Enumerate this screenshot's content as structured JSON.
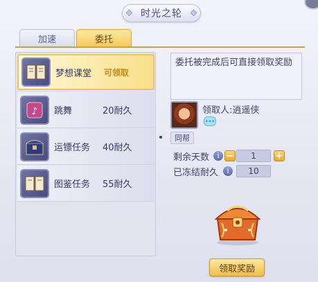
{
  "window": {
    "title": "时光之轮"
  },
  "tabs": [
    {
      "label": "加速",
      "active": false
    },
    {
      "label": "委托",
      "active": true
    }
  ],
  "tasks": [
    {
      "name": "梦想课堂",
      "status": "可领取",
      "icon": "book-icon",
      "selected": true
    },
    {
      "name": "跳舞",
      "cost": "20耐久",
      "icon": "music-scroll-icon",
      "selected": false
    },
    {
      "name": "运镖任务",
      "cost": "40耐久",
      "icon": "treasure-chest-icon",
      "selected": false
    },
    {
      "name": "图鉴任务",
      "cost": "55耐久",
      "icon": "book-icon",
      "selected": false
    }
  ],
  "detail": {
    "description": "委托被完成后可直接领取奖励",
    "receiver": "领取人:逍遥侠",
    "chat_icon": "chat-bubble-icon",
    "tag": "同帮",
    "remaining_days_label": "剩余天数",
    "remaining_days_value": "1",
    "frozen_durability_label": "已冻结耐久",
    "frozen_durability_value": "10",
    "claim_button": "领取奖励"
  },
  "colors": {
    "accent_gold": "#f6c85a",
    "panel_bg": "#e2e3ef",
    "text_primary": "#3a3f6e"
  }
}
